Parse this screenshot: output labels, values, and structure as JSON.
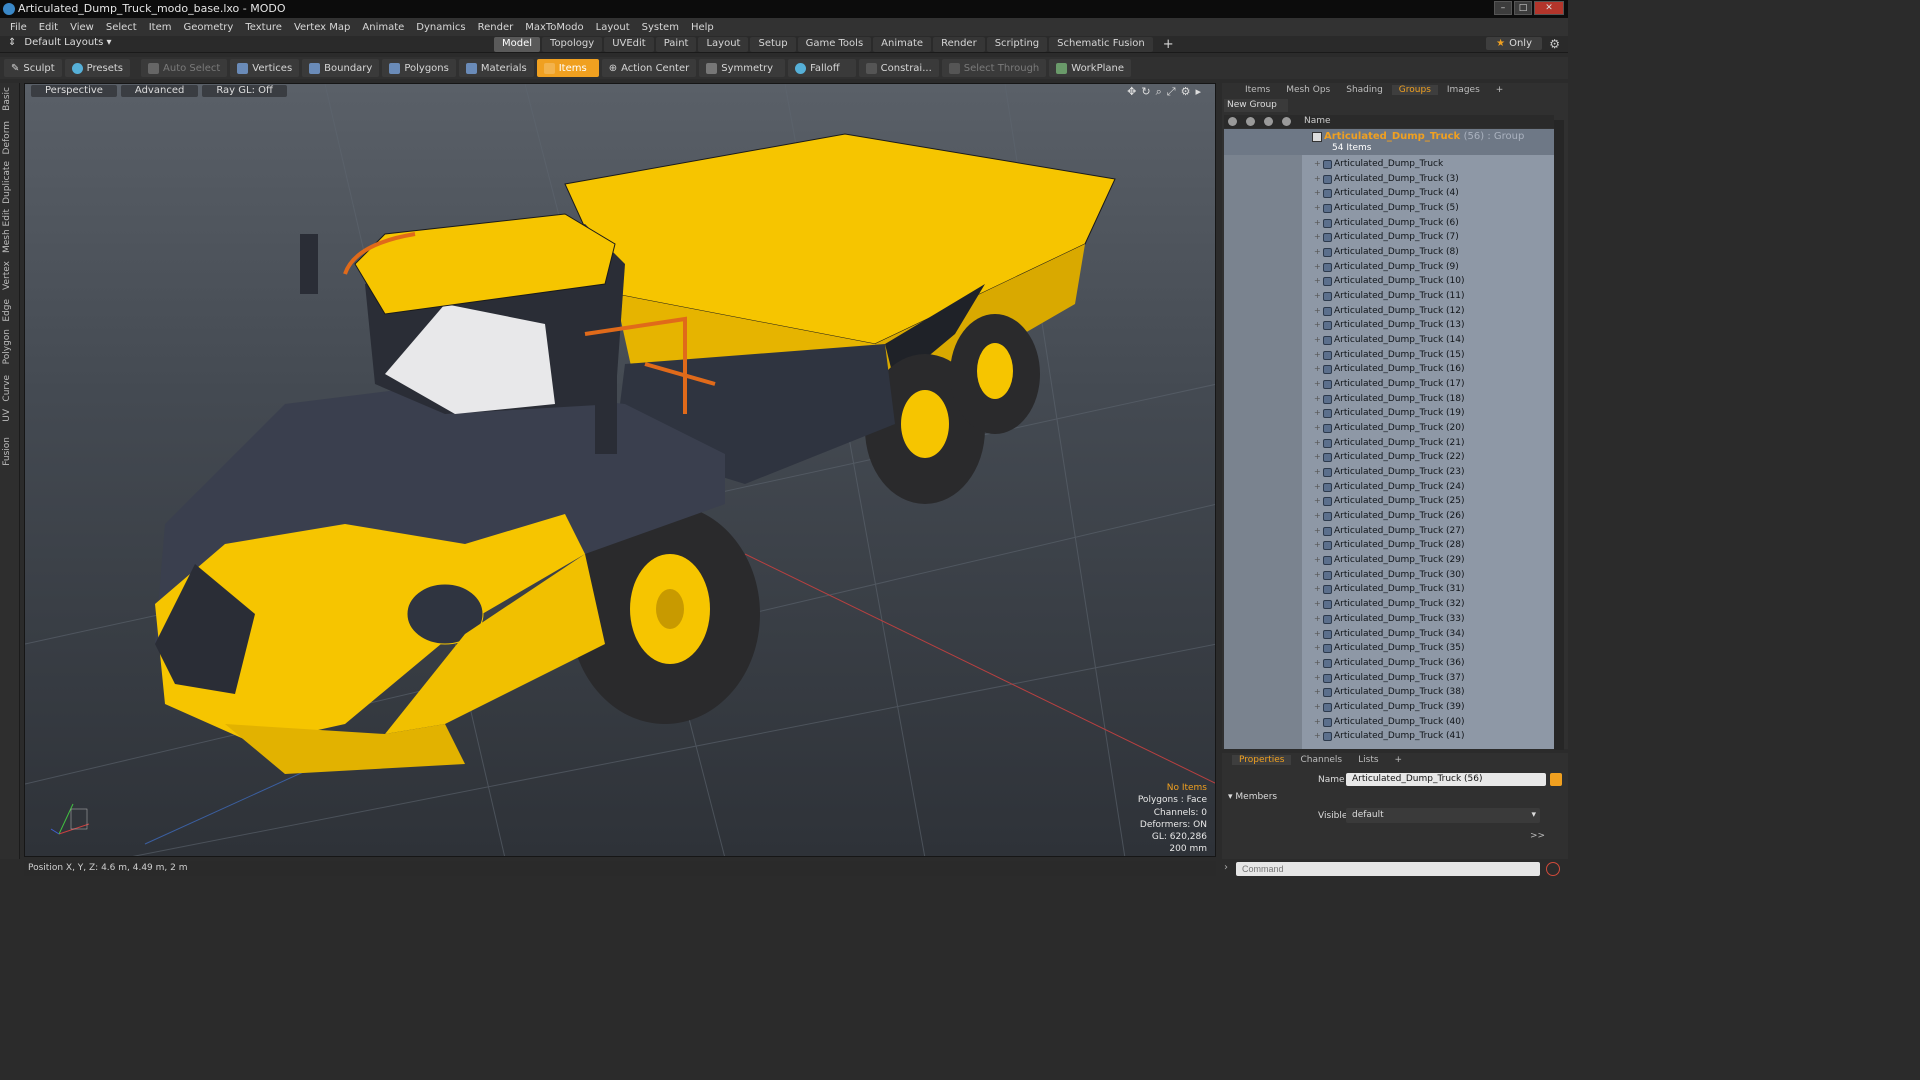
{
  "window": {
    "title": "Articulated_Dump_Truck_modo_base.lxo - MODO"
  },
  "menu": [
    "File",
    "Edit",
    "View",
    "Select",
    "Item",
    "Geometry",
    "Texture",
    "Vertex Map",
    "Animate",
    "Dynamics",
    "Render",
    "MaxToModo",
    "Layout",
    "System",
    "Help"
  ],
  "layoutbar": {
    "default_layouts": "Default Layouts",
    "tabs": [
      "Model",
      "Topology",
      "UVEdit",
      "Paint",
      "Layout",
      "Setup",
      "Game Tools",
      "Animate",
      "Render",
      "Scripting",
      "Schematic Fusion"
    ],
    "active_tab": "Model",
    "only_label": "Only"
  },
  "toolbar": {
    "sculpt": "Sculpt",
    "presets": "Presets",
    "auto_select": "Auto Select",
    "vertices": "Vertices",
    "boundary": "Boundary",
    "polygons": "Polygons",
    "materials": "Materials",
    "items": "Items",
    "action_center": "Action Center",
    "symmetry": "Symmetry",
    "falloff": "Falloff",
    "constraints": "Constrai...",
    "select_through": "Select Through",
    "workplane": "WorkPlane"
  },
  "sidebar_tabs": [
    "Basic",
    "Deform",
    "Duplicate",
    "Mesh Edit",
    "Vertex",
    "Edge",
    "Polygon",
    "Curve",
    "UV",
    "Fusion"
  ],
  "viewport": {
    "view": "Perspective",
    "shading": "Advanced",
    "raygl": "Ray GL: Off",
    "info": {
      "selection": "No Items",
      "polygons": "Polygons : Face",
      "channels": "Channels: 0",
      "deformers": "Deformers: ON",
      "gl": "GL: 620,286",
      "scale": "200 mm"
    }
  },
  "status": {
    "position": "Position X, Y, Z:   4.6 m, 4.49 m, 2 m"
  },
  "panel": {
    "tabs": [
      "Items",
      "Mesh Ops",
      "Shading",
      "Groups",
      "Images"
    ],
    "active_tab": "Groups",
    "new_group": "New Group",
    "name_header": "Name",
    "group": {
      "name": "Articulated_Dump_Truck",
      "count": "(56) : Group",
      "items_label": "54 Items"
    },
    "items": [
      "Articulated_Dump_Truck",
      "Articulated_Dump_Truck (3)",
      "Articulated_Dump_Truck (4)",
      "Articulated_Dump_Truck (5)",
      "Articulated_Dump_Truck (6)",
      "Articulated_Dump_Truck (7)",
      "Articulated_Dump_Truck (8)",
      "Articulated_Dump_Truck (9)",
      "Articulated_Dump_Truck (10)",
      "Articulated_Dump_Truck (11)",
      "Articulated_Dump_Truck (12)",
      "Articulated_Dump_Truck (13)",
      "Articulated_Dump_Truck (14)",
      "Articulated_Dump_Truck (15)",
      "Articulated_Dump_Truck (16)",
      "Articulated_Dump_Truck (17)",
      "Articulated_Dump_Truck (18)",
      "Articulated_Dump_Truck (19)",
      "Articulated_Dump_Truck (20)",
      "Articulated_Dump_Truck (21)",
      "Articulated_Dump_Truck (22)",
      "Articulated_Dump_Truck (23)",
      "Articulated_Dump_Truck (24)",
      "Articulated_Dump_Truck (25)",
      "Articulated_Dump_Truck (26)",
      "Articulated_Dump_Truck (27)",
      "Articulated_Dump_Truck (28)",
      "Articulated_Dump_Truck (29)",
      "Articulated_Dump_Truck (30)",
      "Articulated_Dump_Truck (31)",
      "Articulated_Dump_Truck (32)",
      "Articulated_Dump_Truck (33)",
      "Articulated_Dump_Truck (34)",
      "Articulated_Dump_Truck (35)",
      "Articulated_Dump_Truck (36)",
      "Articulated_Dump_Truck (37)",
      "Articulated_Dump_Truck (38)",
      "Articulated_Dump_Truck (39)",
      "Articulated_Dump_Truck (40)",
      "Articulated_Dump_Truck (41)"
    ]
  },
  "properties": {
    "tabs": [
      "Properties",
      "Channels",
      "Lists"
    ],
    "active_tab": "Properties",
    "name_label": "Name",
    "name_value": "Articulated_Dump_Truck (56)",
    "members_label": "Members",
    "visible_label": "Visible",
    "visible_value": "default"
  },
  "command": {
    "placeholder": "Command"
  },
  "colors": {
    "accent": "#f0a020",
    "truck_yellow": "#f5c400",
    "truck_dark": "#3a3f4e",
    "tree_bg": "#8e98a6"
  }
}
